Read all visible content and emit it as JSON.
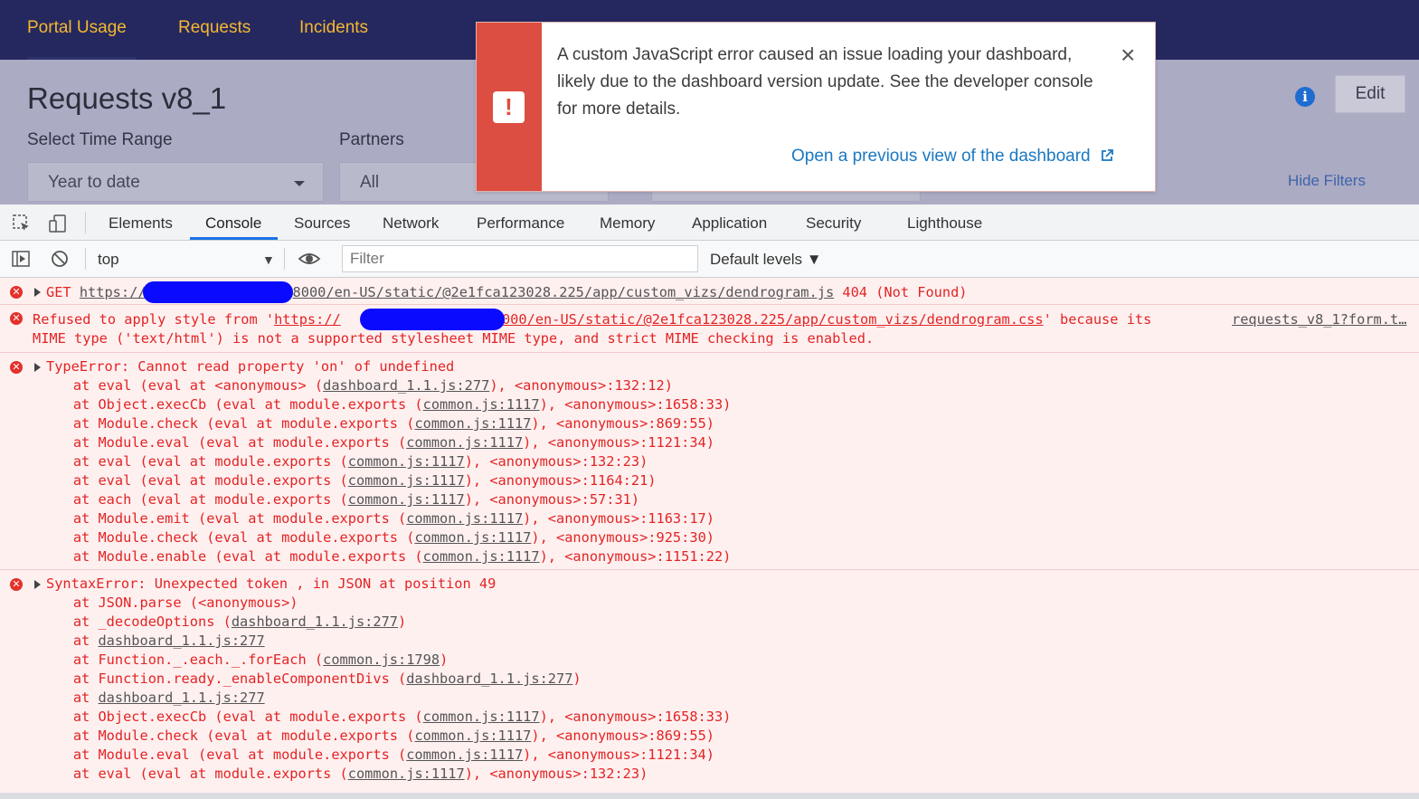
{
  "topnav": {
    "items": [
      "Portal Usage",
      "Requests",
      "Incidents"
    ]
  },
  "dashboard": {
    "title": "Requests v8_1",
    "filters": [
      {
        "label": "Select Time Range",
        "value": "Year to date"
      },
      {
        "label": "Partners",
        "value": "All"
      }
    ],
    "edit_label": "Edit",
    "hide_filters_label": "Hide Filters"
  },
  "toast": {
    "message": "A custom JavaScript error caused an issue loading your dashboard, likely due to the dashboard version update. See the developer console for more details.",
    "link": "Open a previous view of the dashboard",
    "close": "×"
  },
  "devtools": {
    "tabs": [
      "Elements",
      "Console",
      "Sources",
      "Network",
      "Performance",
      "Memory",
      "Application",
      "Security",
      "Lighthouse"
    ],
    "active_tab": "Console",
    "context": "top",
    "filter_placeholder": "Filter",
    "levels": "Default levels ▼"
  },
  "console": {
    "msg1": {
      "prefix": "GET ",
      "url_start": "https://",
      "url_end": "8000/en-US/static/@2e1fca123028.225/app/custom_vizs/dendrogram.js",
      "status": " 404 (Not Found)"
    },
    "msg2": {
      "line1_prefix": "Refused to apply style from '",
      "url_start": "https://",
      "url_end": "8000/en-US/static/@2e1fca123028.225/app/custom_vizs/dendrogram.css",
      "line1_suffix": "' because its",
      "source": "requests_v8_1?form.t…",
      "line2": "MIME type ('text/html') is not a supported stylesheet MIME type, and strict MIME checking is enabled."
    },
    "msg3": {
      "header": "TypeError: Cannot read property 'on' of undefined",
      "stack": [
        {
          "pre": "    at eval (eval at <anonymous> (",
          "link": "dashboard_1.1.js:277",
          "post": "), <anonymous>:132:12)"
        },
        {
          "pre": "    at Object.execCb (eval at module.exports (",
          "link": "common.js:1117",
          "post": "), <anonymous>:1658:33)"
        },
        {
          "pre": "    at Module.check (eval at module.exports (",
          "link": "common.js:1117",
          "post": "), <anonymous>:869:55)"
        },
        {
          "pre": "    at Module.eval (eval at module.exports (",
          "link": "common.js:1117",
          "post": "), <anonymous>:1121:34)"
        },
        {
          "pre": "    at eval (eval at module.exports (",
          "link": "common.js:1117",
          "post": "), <anonymous>:132:23)"
        },
        {
          "pre": "    at eval (eval at module.exports (",
          "link": "common.js:1117",
          "post": "), <anonymous>:1164:21)"
        },
        {
          "pre": "    at each (eval at module.exports (",
          "link": "common.js:1117",
          "post": "), <anonymous>:57:31)"
        },
        {
          "pre": "    at Module.emit (eval at module.exports (",
          "link": "common.js:1117",
          "post": "), <anonymous>:1163:17)"
        },
        {
          "pre": "    at Module.check (eval at module.exports (",
          "link": "common.js:1117",
          "post": "), <anonymous>:925:30)"
        },
        {
          "pre": "    at Module.enable (eval at module.exports (",
          "link": "common.js:1117",
          "post": "), <anonymous>:1151:22)"
        }
      ]
    },
    "msg4": {
      "header": "SyntaxError: Unexpected token , in JSON at position 49",
      "stack": [
        {
          "pre": "    at JSON.parse (<anonymous>)",
          "link": "",
          "post": ""
        },
        {
          "pre": "    at _decodeOptions (",
          "link": "dashboard_1.1.js:277",
          "post": ")"
        },
        {
          "pre": "    at ",
          "link": "dashboard_1.1.js:277",
          "post": ""
        },
        {
          "pre": "    at Function._.each._.forEach (",
          "link": "common.js:1798",
          "post": ")"
        },
        {
          "pre": "    at Function.ready._enableComponentDivs (",
          "link": "dashboard_1.1.js:277",
          "post": ")"
        },
        {
          "pre": "    at ",
          "link": "dashboard_1.1.js:277",
          "post": ""
        },
        {
          "pre": "    at Object.execCb (eval at module.exports (",
          "link": "common.js:1117",
          "post": "), <anonymous>:1658:33)"
        },
        {
          "pre": "    at Module.check (eval at module.exports (",
          "link": "common.js:1117",
          "post": "), <anonymous>:869:55)"
        },
        {
          "pre": "    at Module.eval (eval at module.exports (",
          "link": "common.js:1117",
          "post": "), <anonymous>:1121:34)"
        },
        {
          "pre": "    at eval (eval at module.exports (",
          "link": "common.js:1117",
          "post": "), <anonymous>:132:23)"
        }
      ]
    }
  },
  "colors": {
    "nav_bg": "#25285f",
    "nav_text": "#f4b731",
    "error_red": "#e32424",
    "console_bg": "#fff0f0",
    "toast_strip": "#dc4e41",
    "link_blue": "#1a78c2",
    "redaction": "#0a0aff"
  }
}
